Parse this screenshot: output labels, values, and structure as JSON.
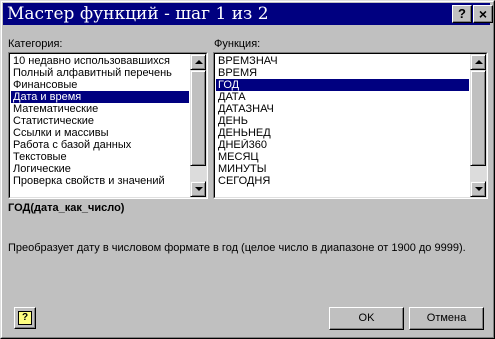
{
  "window": {
    "title": "Мастер функций - шаг 1 из 2",
    "help_button": "?",
    "close_button": "×"
  },
  "category": {
    "label": "Категория:",
    "items": [
      "10 недавно использовавшихся",
      "Полный алфавитный перечень",
      "Финансовые",
      "Дата и время",
      "Математические",
      "Статистические",
      "Ссылки и массивы",
      "Работа с базой данных",
      "Текстовые",
      "Логические",
      "Проверка свойств и значений"
    ],
    "selected": "Дата и время"
  },
  "function": {
    "label": "Функция:",
    "items": [
      "ВРЕМЗНАЧ",
      "ВРЕМЯ",
      "ГОД",
      "ДАТА",
      "ДАТАЗНАЧ",
      "ДЕНЬ",
      "ДЕНЬНЕД",
      "ДНЕЙ360",
      "МЕСЯЦ",
      "МИНУТЫ",
      "СЕГОДНЯ"
    ],
    "selected": "ГОД"
  },
  "syntax": "ГОД(дата_как_число)",
  "description": "Преобразует дату в числовом формате в год (целое число в диапазоне от 1900 до 9999).",
  "buttons": {
    "ok": "OK",
    "cancel": "Отмена",
    "help_icon": "question-icon"
  },
  "colors": {
    "titlebar": "#000080",
    "selection": "#000080",
    "face": "#c0c0c0"
  }
}
